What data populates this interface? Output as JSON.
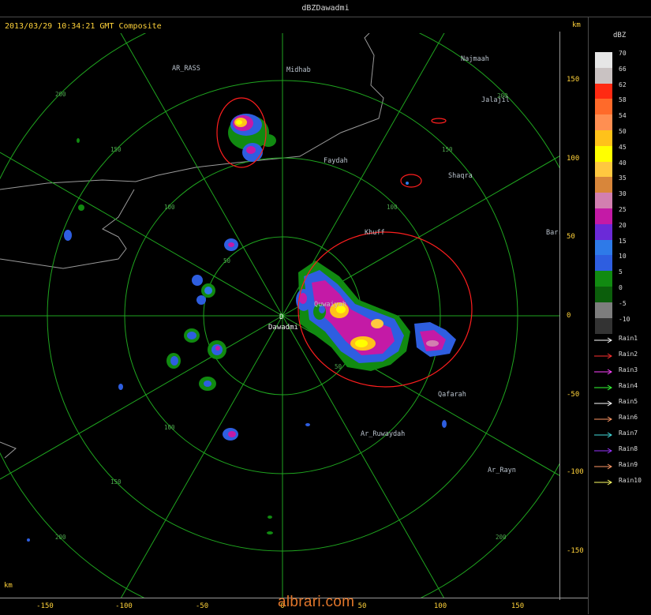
{
  "window": {
    "title": "dBZDawadmi"
  },
  "info": {
    "timestamp_text": "2013/03/29 10:34:21 GMT Composite"
  },
  "units": {
    "top_right": "km",
    "bottom_left": "km",
    "legend_unit": "dBZ"
  },
  "radar": {
    "site_marker": "D",
    "site_name": "Dawadmi"
  },
  "range_ring_labels": [
    "50",
    "100",
    "150",
    "200"
  ],
  "places": [
    {
      "id": "ar-rass",
      "name": "AR_RASS"
    },
    {
      "id": "midhab",
      "name": "Midhab"
    },
    {
      "id": "najmaah",
      "name": "Najmaah"
    },
    {
      "id": "jalajil",
      "name": "Jalajil"
    },
    {
      "id": "faydah",
      "name": "Faydah"
    },
    {
      "id": "shaqra",
      "name": "Shaqra"
    },
    {
      "id": "khuff",
      "name": "Khuff"
    },
    {
      "id": "barra",
      "name": "Barra"
    },
    {
      "id": "quwaiyah",
      "name": "Quwaiyah"
    },
    {
      "id": "qafarah",
      "name": "Qafarah"
    },
    {
      "id": "ar-ruwaydah",
      "name": "Ar_Ruwaydah"
    },
    {
      "id": "ar-rayn",
      "name": "Ar_Rayn"
    }
  ],
  "axes": {
    "y_ticks": [
      "150",
      "100",
      "50",
      "0",
      "-50",
      "-100",
      "-150"
    ],
    "x_ticks": [
      "-150",
      "-100",
      "-50",
      "0",
      "50",
      "100",
      "150"
    ]
  },
  "legend": {
    "scale": [
      {
        "label": "70",
        "color": "#e6e6e6"
      },
      {
        "label": "66",
        "color": "#c9c2c2"
      },
      {
        "label": "62",
        "color": "#ff2a12"
      },
      {
        "label": "58",
        "color": "#ff6a2a"
      },
      {
        "label": "54",
        "color": "#ff8f52"
      },
      {
        "label": "50",
        "color": "#ffc21a"
      },
      {
        "label": "45",
        "color": "#ffff00"
      },
      {
        "label": "40",
        "color": "#ffc840"
      },
      {
        "label": "35",
        "color": "#d8863a"
      },
      {
        "label": "30",
        "color": "#d27fb0"
      },
      {
        "label": "25",
        "color": "#c41aa6"
      },
      {
        "label": "20",
        "color": "#6b2ad8"
      },
      {
        "label": "15",
        "color": "#2e7ae8"
      },
      {
        "label": "10",
        "color": "#2e5ee0"
      },
      {
        "label": "5",
        "color": "#118a11"
      },
      {
        "label": "0",
        "color": "#0b5e0b"
      },
      {
        "label": "-5",
        "color": "#7d7d7d"
      },
      {
        "label": "-10",
        "color": "#333333"
      }
    ],
    "rain_tracks": [
      {
        "label": "Rain1",
        "color": "#ffffff"
      },
      {
        "label": "Rain2",
        "color": "#ff3030"
      },
      {
        "label": "Rain3",
        "color": "#ff44ff"
      },
      {
        "label": "Rain4",
        "color": "#33ff33"
      },
      {
        "label": "Rain5",
        "color": "#ffffff"
      },
      {
        "label": "Rain6",
        "color": "#ff9966"
      },
      {
        "label": "Rain7",
        "color": "#44dddd"
      },
      {
        "label": "Rain8",
        "color": "#9933ff"
      },
      {
        "label": "Rain9",
        "color": "#ff9966"
      },
      {
        "label": "Rain10",
        "color": "#ffff66"
      }
    ]
  },
  "watermark": "albrari.com"
}
